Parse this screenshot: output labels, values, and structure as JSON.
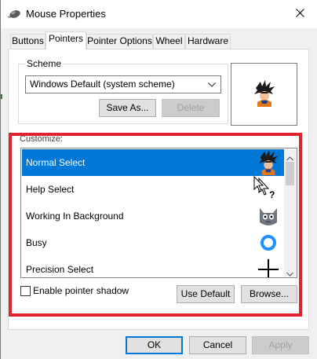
{
  "window": {
    "title": "Mouse Properties",
    "icon": "mouse-icon"
  },
  "tabs": [
    {
      "label": "Buttons",
      "active": false
    },
    {
      "label": "Pointers",
      "active": true
    },
    {
      "label": "Pointer Options",
      "active": false
    },
    {
      "label": "Wheel",
      "active": false
    },
    {
      "label": "Hardware",
      "active": false
    }
  ],
  "scheme": {
    "group_label": "Scheme",
    "selected": "Windows Default (system scheme)",
    "save_as_label": "Save As...",
    "delete_label": "Delete"
  },
  "customize": {
    "label": "Customize:",
    "items": [
      {
        "label": "Normal Select",
        "icon": "character-cursor-icon",
        "selected": true
      },
      {
        "label": "Help Select",
        "icon": "help-select-cursor-icon",
        "selected": false
      },
      {
        "label": "Working In Background",
        "icon": "cat-cursor-icon",
        "selected": false
      },
      {
        "label": "Busy",
        "icon": "busy-ring-cursor-icon",
        "selected": false
      },
      {
        "label": "Precision Select",
        "icon": "crosshair-cursor-icon",
        "selected": false
      }
    ],
    "shadow_label": "Enable pointer shadow",
    "shadow_checked": false,
    "use_default_label": "Use Default",
    "browse_label": "Browse..."
  },
  "footer": {
    "ok_label": "OK",
    "cancel_label": "Cancel",
    "apply_label": "Apply"
  },
  "colors": {
    "selection": "#0078d7",
    "highlight": "#e0242f",
    "busy_ring": "#1e90ff"
  }
}
